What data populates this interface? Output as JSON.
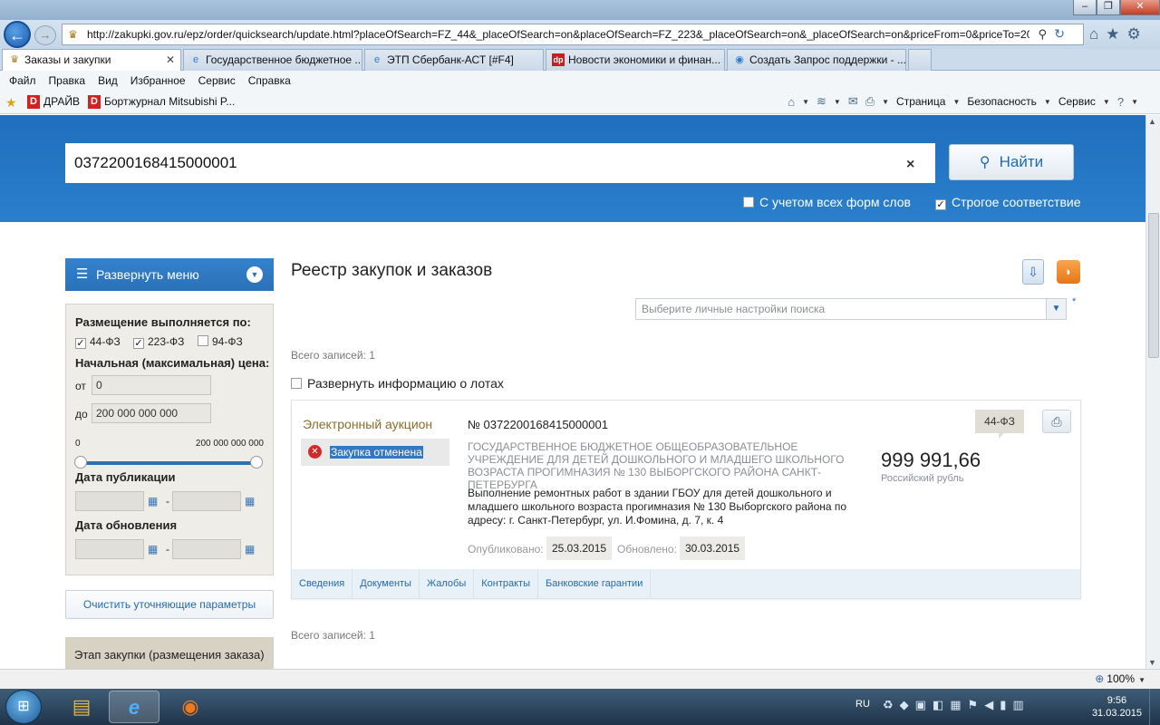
{
  "browser": {
    "url": "http://zakupki.gov.ru/epz/order/quicksearch/update.html?placeOfSearch=FZ_44&_placeOfSearch=on&placeOfSearch=FZ_223&_placeOfSearch=on&_placeOfSearch=on&priceFrom=0&priceTo=20",
    "tabs": [
      {
        "label": "Заказы и закупки",
        "active": true
      },
      {
        "label": "Государственное бюджетное ..."
      },
      {
        "label": "ЭТП Сбербанк-АСТ [#F4]"
      },
      {
        "label": "Новости экономики и финан..."
      },
      {
        "label": "Создать Запрос поддержки - ..."
      }
    ],
    "menu": [
      "Файл",
      "Правка",
      "Вид",
      "Избранное",
      "Сервис",
      "Справка"
    ],
    "favorites": [
      {
        "label": "ДРАЙВ",
        "icon": "D"
      },
      {
        "label": "Бортжурнал Mitsubishi P...",
        "icon": "D"
      }
    ],
    "commands": {
      "page": "Страница",
      "security": "Безопасность",
      "tools": "Сервис"
    },
    "tab_icon_dp": "dp",
    "zoom": "100%"
  },
  "search": {
    "query": "0372200168415000001",
    "button_label": "Найти",
    "clear_symbol": "×",
    "option_all_forms": "С учетом всех форм слов",
    "option_all_forms_checked": false,
    "option_strict": "Строгое соответствие",
    "option_strict_checked": true
  },
  "sidebar": {
    "menu_label": "Развернуть меню",
    "placement_label": "Размещение выполняется по:",
    "laws": [
      {
        "label": "44-ФЗ",
        "checked": true
      },
      {
        "label": "223-ФЗ",
        "checked": true
      },
      {
        "label": "94-ФЗ",
        "checked": false
      }
    ],
    "price_label": "Начальная (максимальная) цена:",
    "from_label": "от",
    "from_value": "0",
    "to_label": "до",
    "to_value": "200 000 000 000",
    "slider_min": "0",
    "slider_max": "200 000 000 000",
    "pub_date_label": "Дата публикации",
    "upd_date_label": "Дата обновления",
    "date_dash": "-",
    "clear_button": "Очистить уточняющие параметры",
    "stage_label": "Этап закупки (размещения заказа)"
  },
  "main": {
    "title": "Реестр закупок и заказов",
    "settings_placeholder": "Выберите личные настройки поиска",
    "settings_asterisk": "*",
    "total_records_top": "Всего записей: 1",
    "total_records_bottom": "Всего записей: 1",
    "expand_lots": "Развернуть информацию о лотах",
    "result": {
      "procurement_type": "Электронный аукцион",
      "status": "Закупка отменена",
      "number": "№ 0372200168415000001",
      "customer": "ГОСУДАРСТВЕННОЕ БЮДЖЕТНОЕ ОБЩЕОБРАЗОВАТЕЛЬНОЕ УЧРЕЖДЕНИЕ ДЛЯ ДЕТЕЙ ДОШКОЛЬНОГО И МЛАДШЕГО ШКОЛЬНОГО ВОЗРАСТА ПРОГИМНАЗИЯ № 130 ВЫБОРГСКОГО РАЙОНА САНКТ-ПЕТЕРБУРГА",
      "description": "Выполнение ремонтных работ в здании ГБОУ для детей дошкольного и младшего школьного возраста прогимназия № 130 Выборгского района по адресу: г. Санкт-Петербург, ул. И.Фомина, д. 7, к. 4",
      "published_label": "Опубликовано:",
      "published_date": "25.03.2015",
      "updated_label": "Обновлено:",
      "updated_date": "30.03.2015",
      "law": "44-ФЗ",
      "price": "999 991,66",
      "currency": "Российский рубль",
      "tabs": [
        "Сведения",
        "Документы",
        "Жалобы",
        "Контракты",
        "Банковские гарантии"
      ]
    }
  },
  "taskbar": {
    "language": "RU",
    "time": "9:56",
    "date": "31.03.2015"
  },
  "colors": {
    "accent": "#2a71b8",
    "header_band": "#1f6fbd",
    "procurement_type": "#8a6d2a",
    "status_cancelled": "#d02a2a"
  }
}
